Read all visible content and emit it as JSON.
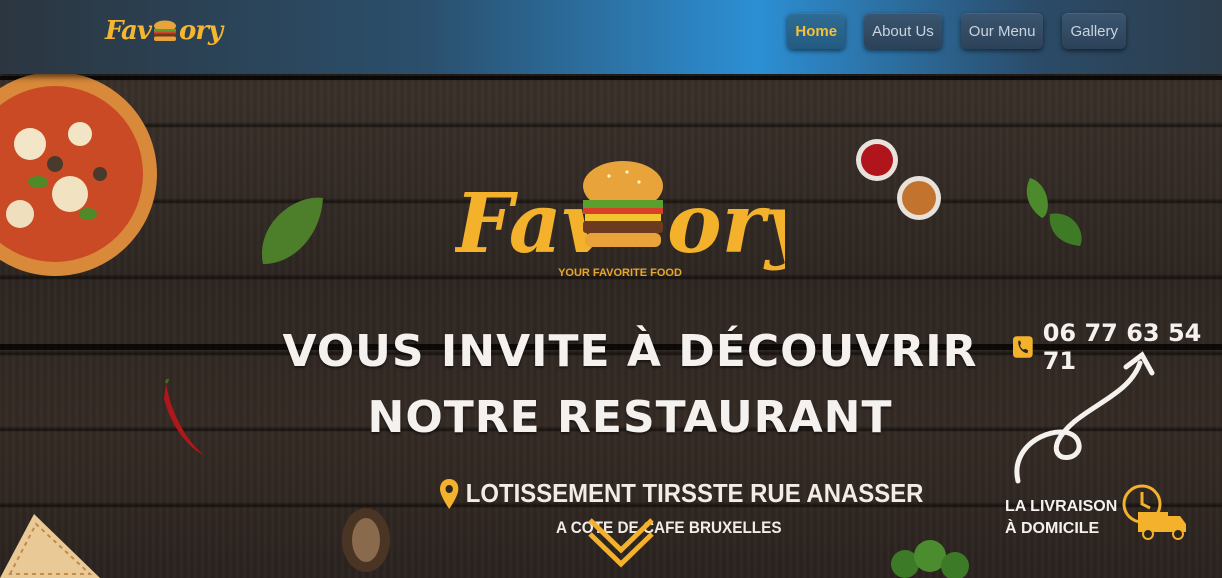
{
  "brand": {
    "name_left": "Fav",
    "name_right": "ory"
  },
  "nav": {
    "items": [
      {
        "label": "Home",
        "active": true
      },
      {
        "label": "About Us",
        "active": false
      },
      {
        "label": "Our Menu",
        "active": false
      },
      {
        "label": "Gallery",
        "active": false
      }
    ]
  },
  "hero": {
    "logo_left": "Fav",
    "logo_right": "ory",
    "tagline": "YOUR FAVORITE FOOD",
    "headline_line1": "VOUS INVITE À DÉCOUVRIR",
    "headline_line2": "NOTRE RESTAURANT",
    "address": "LOTISSEMENT TIRSSTE RUE ANASSER",
    "address_sub": "A COTE DE CAFE BRUXELLES",
    "phone": "06 77 63 54 71",
    "delivery_line1": "LA LIVRAISON",
    "delivery_line2": "À DOMICILE"
  },
  "colors": {
    "brand_yellow": "#f6b530",
    "nav_active": "#f3c13a",
    "nav_bg": "#2c8fd4"
  },
  "icons": {
    "logo": "burger-icon",
    "address": "location-pin-icon",
    "phone": "phone-icon",
    "delivery": "delivery-truck-icon",
    "scroll": "chevron-down-icon"
  }
}
